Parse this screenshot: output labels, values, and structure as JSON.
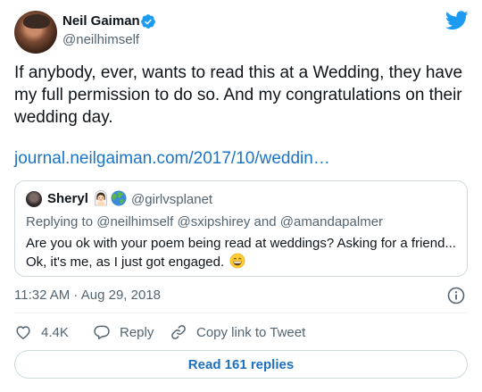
{
  "author": {
    "name": "Neil Gaiman",
    "handle": "@neilhimself",
    "verified": true,
    "avatar_icon": "profile-photo"
  },
  "brand": {
    "icon": "twitter-bird-icon",
    "color": "#1d9bf0"
  },
  "tweet": {
    "text": "If anybody, ever, wants to read this at a Wedding, they have my full permission to do so. And my congratulations on their wedding day.",
    "link": "journal.neilgaiman.com/2017/10/weddin…",
    "link_color": "#1b74c4"
  },
  "quote": {
    "name": "Sheryl",
    "emojis": [
      "woman-with-veil-emoji",
      "globe-emoji"
    ],
    "handle": "@girlvsplanet",
    "replying_to": "Replying to @neilhimself @sxipshirey and @amandapalmer",
    "text": "Are you ok with your poem being read at weddings? Asking for a friend... Ok, it's me, as I just got engaged.",
    "trailing_emoji": "grinning-face-emoji"
  },
  "meta": {
    "timestamp": "11:32 AM · Aug 29, 2018",
    "info_icon": "info-icon"
  },
  "actions": {
    "like_count": "4.4K",
    "reply_label": "Reply",
    "copy_label": "Copy link to Tweet"
  },
  "read_replies": {
    "label": "Read 161 replies",
    "color": "#1d6fbf"
  }
}
